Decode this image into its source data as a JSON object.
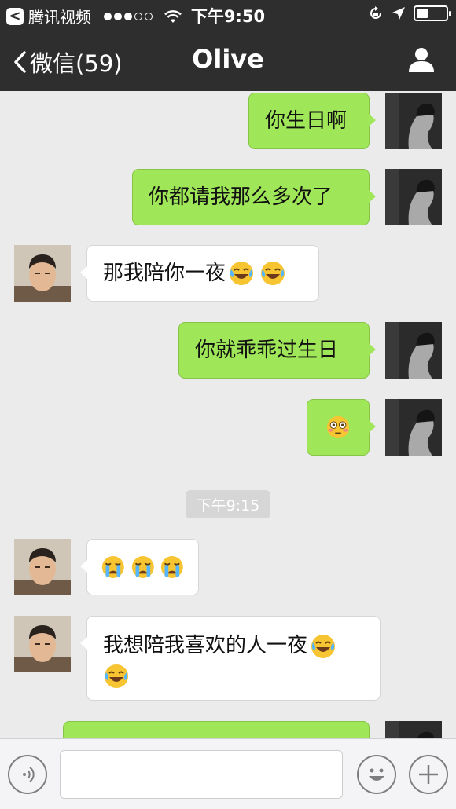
{
  "status_bar": {
    "back_app_glyph": "<",
    "back_app_label": "腾讯视频",
    "time": "下午9:50",
    "battery_level": 0.4
  },
  "nav": {
    "back_label": "微信(59)",
    "title": "Olive"
  },
  "messages": [
    {
      "side": "me",
      "text": "你生日啊"
    },
    {
      "side": "me",
      "text": "你都请我那么多次了"
    },
    {
      "side": "them",
      "text": "那我陪你一夜",
      "emojis": [
        "tears-of-joy",
        "tears-of-joy"
      ]
    },
    {
      "side": "me",
      "text": "你就乖乖过生日"
    },
    {
      "side": "me",
      "text": "",
      "emojis": [
        "flushed"
      ]
    },
    {
      "side": "them",
      "text": "",
      "emojis": [
        "loudly-crying",
        "loudly-crying",
        "loudly-crying"
      ]
    },
    {
      "side": "them",
      "text": "我想陪我喜欢的人一夜",
      "emojis": [
        "tears-of-joy",
        "tears-of-joy"
      ]
    }
  ],
  "timestamp": "下午9:15",
  "input": {
    "value": "",
    "placeholder": ""
  },
  "icons": {
    "voice": "voice-icon",
    "sticker": "sticker-icon",
    "plus": "plus-icon",
    "profile": "profile-icon"
  }
}
